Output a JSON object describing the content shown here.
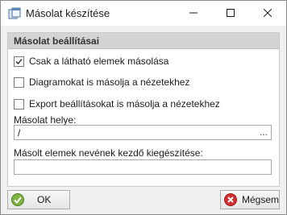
{
  "window": {
    "title": "Másolat készítése"
  },
  "group": {
    "header": "Másolat beállításai"
  },
  "options": [
    {
      "label": "Csak a látható elemek másolása",
      "checked": true
    },
    {
      "label": "Diagramokat is másolja a nézetekhez",
      "checked": false
    },
    {
      "label": "Export beállításokat is másolja a nézetekhez",
      "checked": false
    }
  ],
  "copy_location": {
    "label": "Másolat helye:",
    "value": "/",
    "browse": "..."
  },
  "suffix": {
    "label": "Másolt elemek nevének kezdő kiegészítése:",
    "value": ""
  },
  "buttons": {
    "ok": "OK",
    "cancel": "Mégsem"
  },
  "icons": {
    "app": "window-copy-icon",
    "minimize": "minimize-icon",
    "maximize": "maximize-icon",
    "close": "close-icon",
    "ok": "green-check-icon",
    "cancel": "red-x-icon"
  },
  "colors": {
    "ok_icon": "#7cb342",
    "cancel_icon": "#d32f2f",
    "group_header": "#d4d4d4"
  }
}
